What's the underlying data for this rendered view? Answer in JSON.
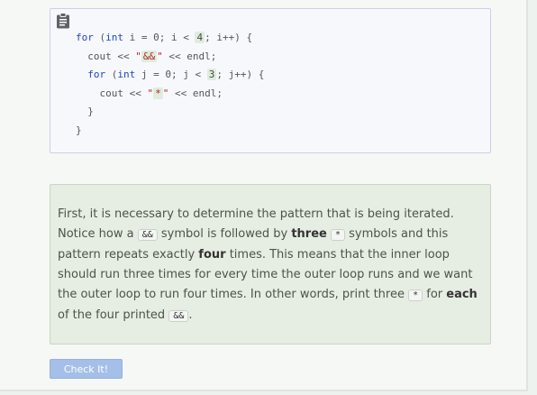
{
  "code": {
    "lines": [
      {
        "indent": "",
        "tokens": [
          [
            "kw",
            "for"
          ],
          [
            "op",
            " ("
          ],
          [
            "kw",
            "int"
          ],
          [
            "op",
            " i = 0; i < "
          ],
          [
            "hl",
            "4"
          ],
          [
            "op",
            "; i++) {"
          ]
        ]
      },
      {
        "indent": "  ",
        "tokens": [
          [
            "op",
            "cout << "
          ],
          [
            "str",
            "\""
          ],
          [
            "strhl",
            "&&"
          ],
          [
            "str",
            "\""
          ],
          [
            "op",
            " << endl;"
          ]
        ]
      },
      {
        "indent": "  ",
        "tokens": [
          [
            "kw",
            "for"
          ],
          [
            "op",
            " ("
          ],
          [
            "kw",
            "int"
          ],
          [
            "op",
            " j = 0; j < "
          ],
          [
            "hl",
            "3"
          ],
          [
            "op",
            "; j++) {"
          ]
        ]
      },
      {
        "indent": "    ",
        "tokens": [
          [
            "op",
            "cout << "
          ],
          [
            "str",
            "\""
          ],
          [
            "strhl",
            "*"
          ],
          [
            "str",
            "\""
          ],
          [
            "op",
            " << endl;"
          ]
        ]
      },
      {
        "indent": "  ",
        "tokens": [
          [
            "op",
            "}"
          ]
        ]
      },
      {
        "indent": "",
        "tokens": [
          [
            "op",
            "}"
          ]
        ]
      }
    ]
  },
  "explanation": {
    "segments": [
      {
        "t": "text",
        "v": "First, it is necessary to determine the pattern that is being iterated. Notice how a "
      },
      {
        "t": "chip",
        "v": "&&"
      },
      {
        "t": "text",
        "v": " symbol is followed by "
      },
      {
        "t": "bold",
        "v": "three"
      },
      {
        "t": "text",
        "v": " "
      },
      {
        "t": "chip",
        "v": "*"
      },
      {
        "t": "text",
        "v": " symbols and this pattern repeats exactly "
      },
      {
        "t": "bold",
        "v": "four"
      },
      {
        "t": "text",
        "v": " times. This means that the inner loop should run three times for every time the outer loop runs and we want the outer loop to run four times. In other words, print three "
      },
      {
        "t": "chip",
        "v": "*"
      },
      {
        "t": "text",
        "v": " for "
      },
      {
        "t": "bold",
        "v": "each"
      },
      {
        "t": "text",
        "v": " of the four printed "
      },
      {
        "t": "chip",
        "v": "&&"
      },
      {
        "t": "text",
        "v": "."
      }
    ]
  },
  "button": {
    "label": "Check It!"
  },
  "icons": {
    "copy": "clipboard-icon"
  },
  "colors": {
    "button_bg": "#a4bfe8",
    "keyword": "#1f46c5",
    "string": "#b32424"
  }
}
